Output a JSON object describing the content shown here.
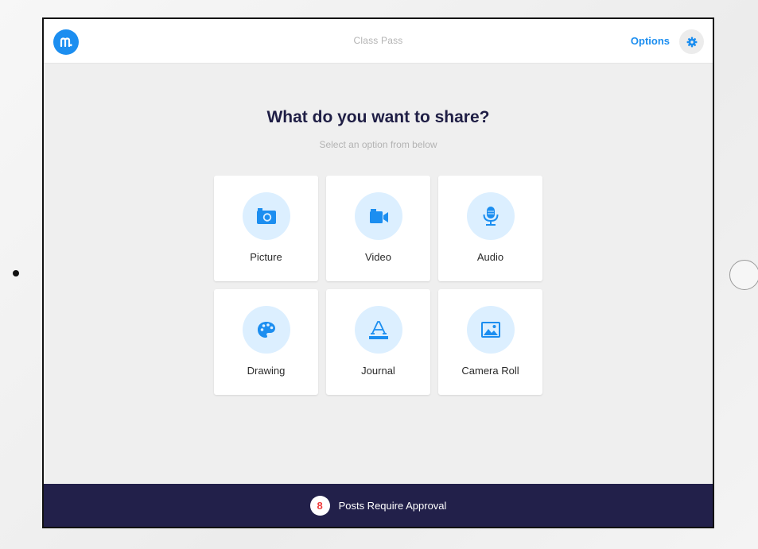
{
  "header": {
    "title": "Class Pass",
    "options_label": "Options",
    "logo_icon": "seesaw-logo-icon",
    "settings_icon": "gear-icon"
  },
  "main": {
    "heading": "What do you want to share?",
    "subheading": "Select an option from below",
    "options": [
      {
        "label": "Picture",
        "icon": "camera-icon"
      },
      {
        "label": "Video",
        "icon": "video-camera-icon"
      },
      {
        "label": "Audio",
        "icon": "microphone-icon"
      },
      {
        "label": "Drawing",
        "icon": "palette-icon"
      },
      {
        "label": "Journal",
        "icon": "text-a-icon"
      },
      {
        "label": "Camera Roll",
        "icon": "image-icon"
      }
    ]
  },
  "footer": {
    "pending_count": "8",
    "approval_text": "Posts Require Approval"
  },
  "colors": {
    "accent": "#1c8ef0",
    "icon_bg": "#dcefff",
    "footer_bg": "#22204a",
    "heading": "#1f1e45",
    "badge_text": "#ef3b3b"
  }
}
